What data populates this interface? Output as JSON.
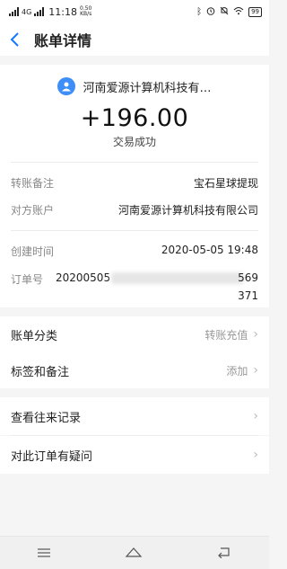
{
  "status_bar": {
    "network": "4G",
    "time": "11:18",
    "netspeed": "0.50\nKB/s",
    "battery": "99"
  },
  "header": {
    "title": "账单详情"
  },
  "summary": {
    "merchant": "河南爱源计算机科技有…",
    "amount": "+196.00",
    "status": "交易成功"
  },
  "details": [
    {
      "label": "转账备注",
      "value": "宝石星球提现"
    },
    {
      "label": "对方账户",
      "value": "河南爱源计算机科技有限公司"
    },
    {
      "label": "创建时间",
      "value": "2020-05-05 19:48"
    }
  ],
  "order": {
    "label": "订单号",
    "prefix": "20200505",
    "suffix_line1": "569",
    "suffix_line2": "371"
  },
  "list1": [
    {
      "label": "账单分类",
      "value": "转账充值"
    },
    {
      "label": "标签和备注",
      "value": "添加"
    }
  ],
  "list2": [
    {
      "label": "查看往来记录"
    },
    {
      "label": "对此订单有疑问"
    }
  ]
}
